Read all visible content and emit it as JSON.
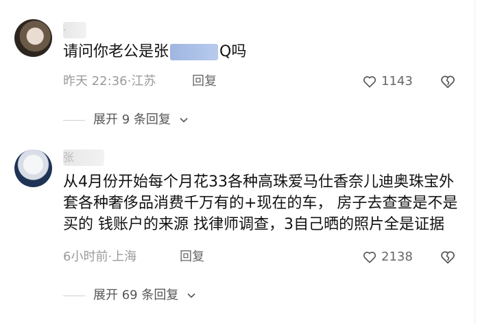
{
  "comments": [
    {
      "username": "·",
      "text_before": "请问你老公是",
      "text_prefix_char": "张",
      "text_after_char": "Q",
      "text_after": "吗",
      "time": "昨天 22:36",
      "location": "江苏",
      "reply_label": "回复",
      "likes": "1143",
      "expand_label": "展开 9 条回复"
    },
    {
      "username": "张",
      "text": "从4月份开始每个月花33各种高珠爱马仕香奈儿迪奥珠宝外套各种奢侈品消费千万有的+现在的车， 房子去查查是不是买的 钱账户的来源 找律师调查，3自己晒的照片全是证据",
      "time": "6小时前",
      "location": "上海",
      "reply_label": "回复",
      "likes": "2138",
      "expand_label": "展开 69 条回复"
    }
  ],
  "icons": {
    "like": "heart-outline-icon",
    "dislike": "broken-heart-icon",
    "expand": "chevron-down-icon"
  },
  "colors": {
    "text": "#111111",
    "meta": "#9a9a9a",
    "blur": "#a9bfe8"
  }
}
